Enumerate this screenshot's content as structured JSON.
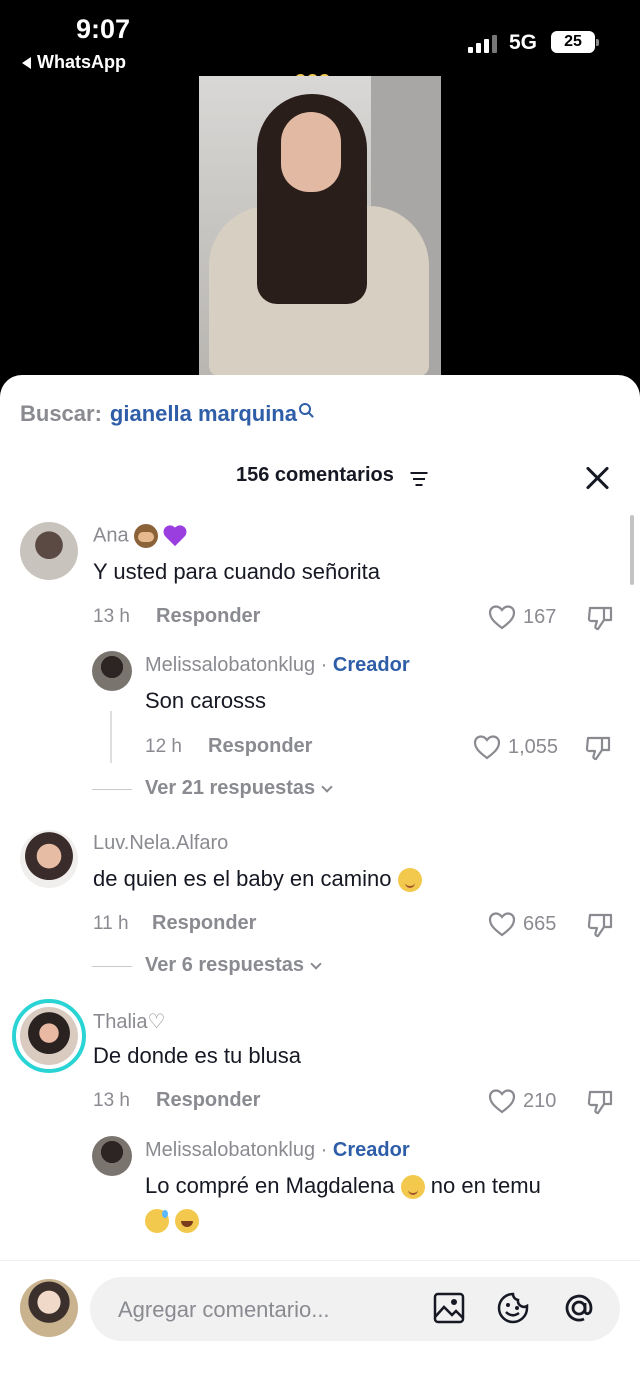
{
  "status_bar": {
    "time": "9:07",
    "back_app": "WhatsApp",
    "network": "5G",
    "battery": "25"
  },
  "search": {
    "prefix": "Buscar:",
    "term": "gianella marquina"
  },
  "header": {
    "count_label": "156 comentarios"
  },
  "comments": [
    {
      "username": "Ana",
      "username_emojis": [
        "see-no-evil-monkey",
        "purple-heart"
      ],
      "text": "Y usted para cuando señorita",
      "time": "13 h",
      "reply_label": "Responder",
      "likes": "167",
      "replies": [
        {
          "username": "Melissalobatonklug",
          "separator": "·",
          "creator_tag": "Creador",
          "text": "Son carosss",
          "time": "12 h",
          "reply_label": "Responder",
          "likes": "1,055"
        }
      ],
      "view_replies": "Ver 21 respuestas"
    },
    {
      "username": "Luv.Nela.Alfaro",
      "text": "de quien es el baby en camino",
      "text_emoji": "smiling-face-with-hearts",
      "time": "11 h",
      "reply_label": "Responder",
      "likes": "665",
      "view_replies": "Ver 6 respuestas"
    },
    {
      "username": "Thalia♡",
      "text": "De donde es tu blusa",
      "time": "13 h",
      "reply_label": "Responder",
      "likes": "210",
      "replies": [
        {
          "username": "Melissalobatonklug",
          "separator": "·",
          "creator_tag": "Creador",
          "text_part1": "Lo compré en Magdalena",
          "text_part2": "no en temu",
          "text_emojis": [
            "smiling-face-with-hearts",
            "grinning-sweat",
            "tears-of-joy",
            "tears-of-joy"
          ]
        }
      ]
    }
  ],
  "composer": {
    "placeholder": "Agregar comentario...",
    "icons": [
      "image-icon",
      "emoji-icon",
      "mention-icon"
    ]
  },
  "colors": {
    "accent_blue": "#2f5ea8",
    "muted_gray": "#8a8b91",
    "text_dark": "#161823",
    "story_ring": "#2bd4d4"
  }
}
